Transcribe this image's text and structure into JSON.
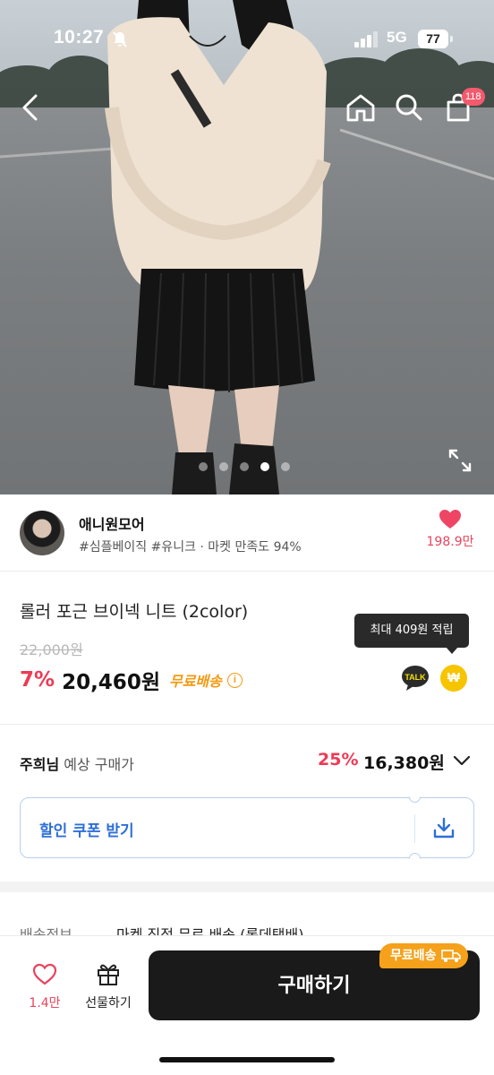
{
  "status_bar": {
    "time": "10:27",
    "network": "5G",
    "battery": "77"
  },
  "header": {
    "cart_count": "118"
  },
  "gallery": {
    "total": 5,
    "active_index": 3
  },
  "seller": {
    "name": "애니원모어",
    "tags": "#심플베이직 #유니크 · 마켓 만족도 94%",
    "likes": "198.9만"
  },
  "product": {
    "title": "롤러 포근 브이넥 니트 (2color)",
    "original_price": "22,000원",
    "discount": "7%",
    "price": "20,460원",
    "free_shipping": "무료배송",
    "info_glyph": "i",
    "tooltip": "최대 409원 적립",
    "talk_label": "TALK",
    "point_glyph": "₩"
  },
  "member_price": {
    "user": "주희님",
    "label": " 예상 구매가",
    "discount": "25%",
    "price": "16,380원"
  },
  "coupon": {
    "label": "할인 쿠폰 받기"
  },
  "shipping": {
    "label": "배송정보",
    "value": "마켓 직접 무료 배송 (롯데택배)"
  },
  "bottom_bar": {
    "like_count": "1.4만",
    "gift_label": "선물하기",
    "buy_label": "구매하기",
    "free_badge": "무료배송"
  },
  "colors": {
    "accent_red": "#ee3a55",
    "free_ship_orange": "#f29a13",
    "coupon_blue": "#2f6fd6",
    "buy_button": "#1a1a1a"
  }
}
